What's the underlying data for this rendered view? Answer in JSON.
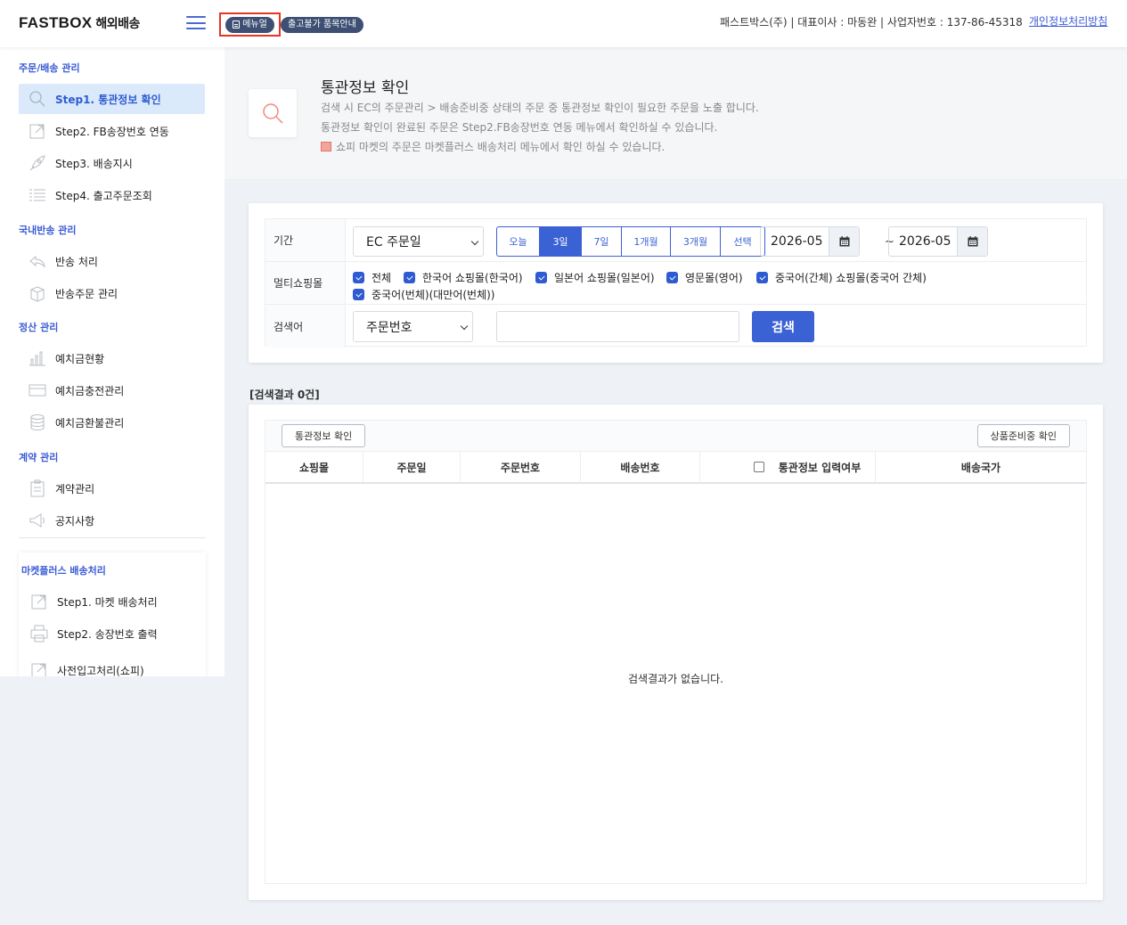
{
  "header": {
    "logo": "FASTBOX",
    "logo_sub": "해외배송",
    "manual_label": "메뉴얼",
    "notice_label": "출고불가 품목안내",
    "company_info": "패스트박스(주) | 대표이사 : 마동완 | 사업자번호 : 137-86-45318",
    "privacy_link": "개인정보처리방침"
  },
  "sidebar": {
    "sections": [
      {
        "title": "주문/배송 관리",
        "items": [
          {
            "label": "Step1. 통관정보 확인",
            "icon": "search-icon",
            "active": true
          },
          {
            "label": "Step2. FB송장번호 연동",
            "icon": "link-out-icon"
          },
          {
            "label": "Step3. 배송지시",
            "icon": "rocket-icon"
          },
          {
            "label": "Step4. 출고주문조회",
            "icon": "list-icon"
          }
        ]
      },
      {
        "title": "국내반송 관리",
        "items": [
          {
            "label": "반송 처리",
            "icon": "return-arrow-icon"
          },
          {
            "label": "반송주문 관리",
            "icon": "return-box-icon"
          }
        ]
      },
      {
        "title": "정산 관리",
        "items": [
          {
            "label": "예치금현황",
            "icon": "bar-chart-icon"
          },
          {
            "label": "예치금충전관리",
            "icon": "card-icon"
          },
          {
            "label": "예치금환불관리",
            "icon": "coins-icon"
          }
        ]
      },
      {
        "title": "계약 관리",
        "items": [
          {
            "label": "계약관리",
            "icon": "clipboard-icon"
          },
          {
            "label": "공지사항",
            "icon": "megaphone-icon"
          }
        ]
      }
    ],
    "marketplus": {
      "title": "마켓플러스 배송처리",
      "items": [
        {
          "label": "Step1. 마켓 배송처리",
          "icon": "link-out-icon"
        },
        {
          "label": "Step2. 송장번호 출력",
          "icon": "printer-icon"
        },
        {
          "label": "사전입고처리(쇼피)",
          "icon": "link-out-icon"
        }
      ]
    }
  },
  "page": {
    "title": "통관정보 확인",
    "desc1": "검색 시 EC의 주문관리 > 배송준비중 상태의 주문 중 통관정보 확인이 필요한 주문을 노출 합니다.",
    "desc2": "통관정보 확인이 완료된 주문은 Step2.FB송장번호 연동 메뉴에서 확인하실 수 있습니다.",
    "desc3": "쇼피 마켓의 주문은 마켓플러스 배송처리 메뉴에서 확인 하실 수 있습니다."
  },
  "search": {
    "period_label": "기간",
    "date_type": "EC 주문일",
    "period_buttons": [
      "오늘",
      "3일",
      "7일",
      "1개월",
      "3개월",
      "선택"
    ],
    "period_selected": "3일",
    "date_from": "2026-05",
    "date_to": "2026-05",
    "tilde": "~",
    "mall_label": "멀티쇼핑몰",
    "malls": [
      "전체",
      "한국어 쇼핑몰(한국어)",
      "일본어 쇼핑몰(일본어)",
      "영문몰(영어)",
      "중국어(간체) 쇼핑몰(중국어 간체)",
      "중국어(번체)(대만어(번체))"
    ],
    "keyword_label": "검색어",
    "keyword_type": "주문번호",
    "keyword_value": "",
    "search_button": "검색"
  },
  "results": {
    "count_text": "[검색결과 0건]",
    "btn_customs": "통관정보 확인",
    "btn_prepare": "상품준비중 확인",
    "columns": [
      "쇼핑몰",
      "주문일",
      "주문번호",
      "배송번호",
      "",
      "통관정보 입력여부",
      "배송국가"
    ],
    "empty_text": "검색결과가 없습니다."
  },
  "colors": {
    "accent": "#3b62d4",
    "active_bg": "#dbeafb",
    "highlight_box": "#e53523"
  }
}
